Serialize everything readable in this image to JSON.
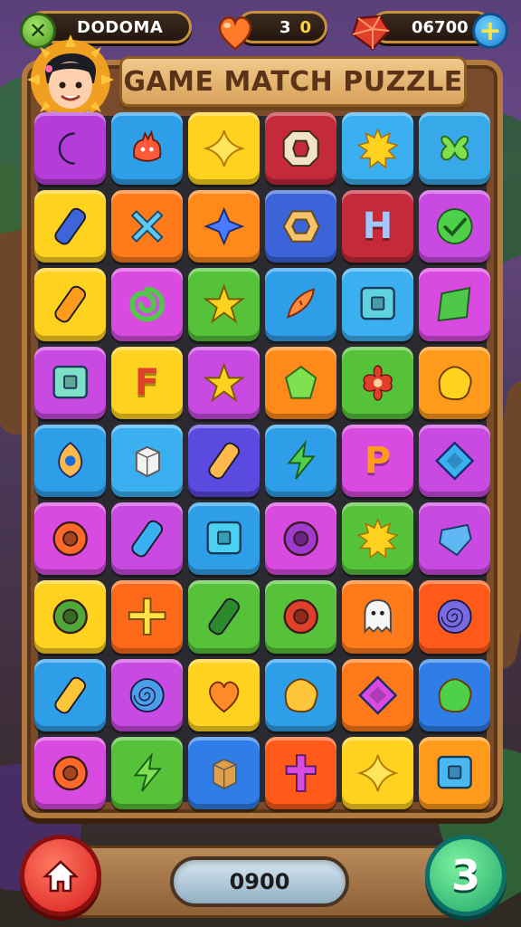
{
  "header": {
    "player_name": "DODOMA",
    "lives_count": "3",
    "lives_extra": "0",
    "coins": "06700"
  },
  "board": {
    "title": "GAME MATCH PUZZLE",
    "tiles": [
      {
        "color": "#b63cd9",
        "shape": "crescent",
        "fg": "#5a7bff"
      },
      {
        "color": "#2f9ee8",
        "shape": "blob-monster",
        "fg": "#ff5a3a"
      },
      {
        "color": "#ffd21f",
        "shape": "star4",
        "fg": "#ffe55a"
      },
      {
        "color": "#c42a3a",
        "shape": "octagon-ring",
        "fg": "#f1e3c8"
      },
      {
        "color": "#3bb0f0",
        "shape": "sun",
        "fg": "#ffd21f"
      },
      {
        "color": "#37a9e8",
        "shape": "clover",
        "fg": "#7fe04f"
      },
      {
        "color": "#ffd21f",
        "shape": "capsule",
        "fg": "#3d64d8"
      },
      {
        "color": "#ff7a1a",
        "shape": "x",
        "fg": "#5fc8f2"
      },
      {
        "color": "#ff8a1a",
        "shape": "diamond-star",
        "fg": "#4a7bff"
      },
      {
        "color": "#3a64d8",
        "shape": "hexagon",
        "fg": "#f5c36a"
      },
      {
        "color": "#c42a3a",
        "shape": "letter",
        "letter": "H",
        "fg": "#9ec8ff"
      },
      {
        "color": "#c94ae0",
        "shape": "check",
        "fg": "#4fd04a"
      },
      {
        "color": "#ffd21f",
        "shape": "capsule",
        "fg": "#ff9a1a"
      },
      {
        "color": "#d94ae0",
        "shape": "swirl",
        "fg": "#4fc84a"
      },
      {
        "color": "#56c23a",
        "shape": "star5",
        "fg": "#ffd21f"
      },
      {
        "color": "#2f9ee8",
        "shape": "fish",
        "fg": "#ff8a3a"
      },
      {
        "color": "#3bb0f0",
        "shape": "square-ring",
        "fg": "#5fd2e0"
      },
      {
        "color": "#d94ae0",
        "shape": "square",
        "fg": "#4fc84a"
      },
      {
        "color": "#c94ae0",
        "shape": "square-ring",
        "fg": "#7fe0c8"
      },
      {
        "color": "#ffd21f",
        "shape": "letter",
        "letter": "F",
        "fg": "#e0402a"
      },
      {
        "color": "#c94ae0",
        "shape": "star5",
        "fg": "#ffd21f"
      },
      {
        "color": "#ff8a1a",
        "shape": "pentagon",
        "fg": "#7fe04f"
      },
      {
        "color": "#56c23a",
        "shape": "flower",
        "fg": "#e0402a"
      },
      {
        "color": "#ff9a1a",
        "shape": "blob",
        "fg": "#ffd21f"
      },
      {
        "color": "#2f9ee8",
        "shape": "drop",
        "fg": "#ffb84a"
      },
      {
        "color": "#3bb0f0",
        "shape": "cube",
        "fg": "#f2f2f2"
      },
      {
        "color": "#5a4ae0",
        "shape": "capsule",
        "fg": "#ffb84a"
      },
      {
        "color": "#2f9ee8",
        "shape": "bolt",
        "fg": "#4fd04a"
      },
      {
        "color": "#d94ae0",
        "shape": "letter",
        "letter": "P",
        "fg": "#ff9a1a"
      },
      {
        "color": "#c94ae0",
        "shape": "diamond",
        "fg": "#3bb0f0"
      },
      {
        "color": "#d94ae0",
        "shape": "ring",
        "fg": "#ff6a2a"
      },
      {
        "color": "#c94ae0",
        "shape": "capsule",
        "fg": "#3bb0f0"
      },
      {
        "color": "#2f9ee8",
        "shape": "square-ring",
        "fg": "#4ad0f0"
      },
      {
        "color": "#d94ae0",
        "shape": "ring",
        "fg": "#a03ad0"
      },
      {
        "color": "#56c23a",
        "shape": "sun",
        "fg": "#ffd21f"
      },
      {
        "color": "#c94ae0",
        "shape": "gem",
        "fg": "#5fb8f2"
      },
      {
        "color": "#ffd21f",
        "shape": "ring",
        "fg": "#4fa83a"
      },
      {
        "color": "#ff6a1a",
        "shape": "plus-star",
        "fg": "#ffe14a"
      },
      {
        "color": "#56c23a",
        "shape": "capsule",
        "fg": "#2c8a2c"
      },
      {
        "color": "#56c23a",
        "shape": "ring",
        "fg": "#e0402a"
      },
      {
        "color": "#ff7a1a",
        "shape": "ghost",
        "fg": "#f5f5f5"
      },
      {
        "color": "#ff5a1a",
        "shape": "spiral",
        "fg": "#7a6ae0"
      },
      {
        "color": "#2f9ee8",
        "shape": "capsule",
        "fg": "#ffc63a"
      },
      {
        "color": "#c94ae0",
        "shape": "spiral",
        "fg": "#4a9ee8"
      },
      {
        "color": "#ffd21f",
        "shape": "heart",
        "fg": "#ff8a2a"
      },
      {
        "color": "#2f9ee8",
        "shape": "blob",
        "fg": "#ffc63a"
      },
      {
        "color": "#ff7a1a",
        "shape": "diamond",
        "fg": "#d94ae0"
      },
      {
        "color": "#2f7ee8",
        "shape": "blob",
        "fg": "#4fd04a"
      },
      {
        "color": "#d94ae0",
        "shape": "ring",
        "fg": "#ff6a2a"
      },
      {
        "color": "#56c23a",
        "shape": "bolt",
        "fg": "#7fe04f"
      },
      {
        "color": "#2f7ee8",
        "shape": "cube",
        "fg": "#e0a04a"
      },
      {
        "color": "#ff5a1a",
        "shape": "cross",
        "fg": "#d94ae0"
      },
      {
        "color": "#ffd21f",
        "shape": "star4",
        "fg": "#ffe55a"
      },
      {
        "color": "#ff9a1a",
        "shape": "square-ring",
        "fg": "#4ab8f2"
      }
    ]
  },
  "footer": {
    "score": "0900",
    "next_label": "3"
  }
}
